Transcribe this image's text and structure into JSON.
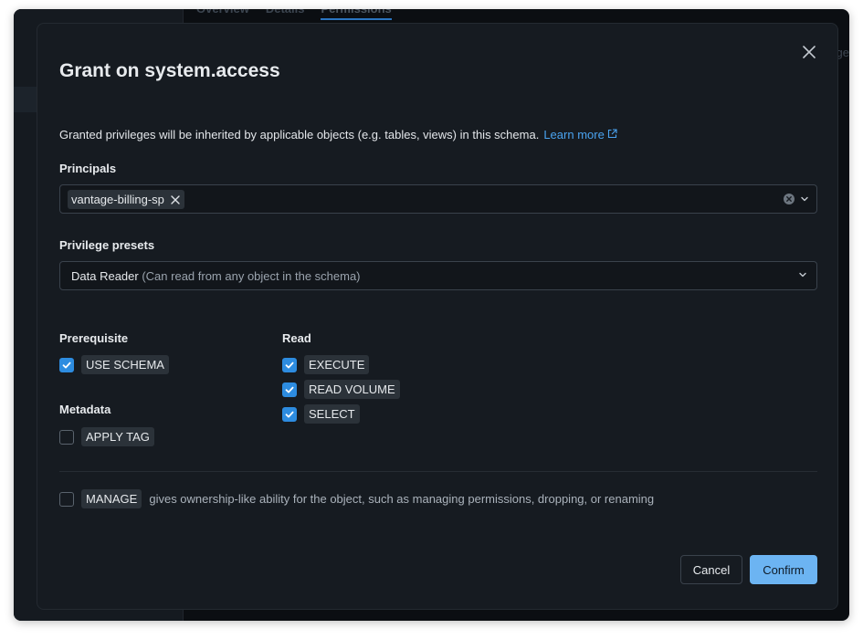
{
  "background": {
    "tabs": [
      "Overview",
      "Details",
      "Permissions"
    ],
    "right_text": "ge"
  },
  "modal": {
    "title": "Grant on system.access",
    "description": "Granted privileges will be inherited by applicable objects (e.g. tables, views) in this schema.",
    "learn_more": "Learn more",
    "principals": {
      "label": "Principals",
      "chip": "vantage-billing-sp"
    },
    "presets": {
      "label": "Privilege presets",
      "selected": "Data Reader",
      "selected_desc": "(Can read from any object in the schema)"
    },
    "groups": {
      "prerequisite": {
        "title": "Prerequisite",
        "items": [
          {
            "label": "USE SCHEMA",
            "checked": true
          }
        ]
      },
      "metadata": {
        "title": "Metadata",
        "items": [
          {
            "label": "APPLY TAG",
            "checked": false
          }
        ]
      },
      "read": {
        "title": "Read",
        "items": [
          {
            "label": "EXECUTE",
            "checked": true
          },
          {
            "label": "READ VOLUME",
            "checked": true
          },
          {
            "label": "SELECT",
            "checked": true
          }
        ]
      }
    },
    "manage": {
      "label": "MANAGE",
      "checked": false,
      "description": "gives ownership-like ability for the object, such as managing permissions, dropping, or renaming"
    },
    "buttons": {
      "cancel": "Cancel",
      "confirm": "Confirm"
    }
  },
  "colors": {
    "accent": "#2d8ce0",
    "link": "#4aa3f0",
    "confirm_bg": "#6cb4f2",
    "modal_bg": "#161b21"
  }
}
